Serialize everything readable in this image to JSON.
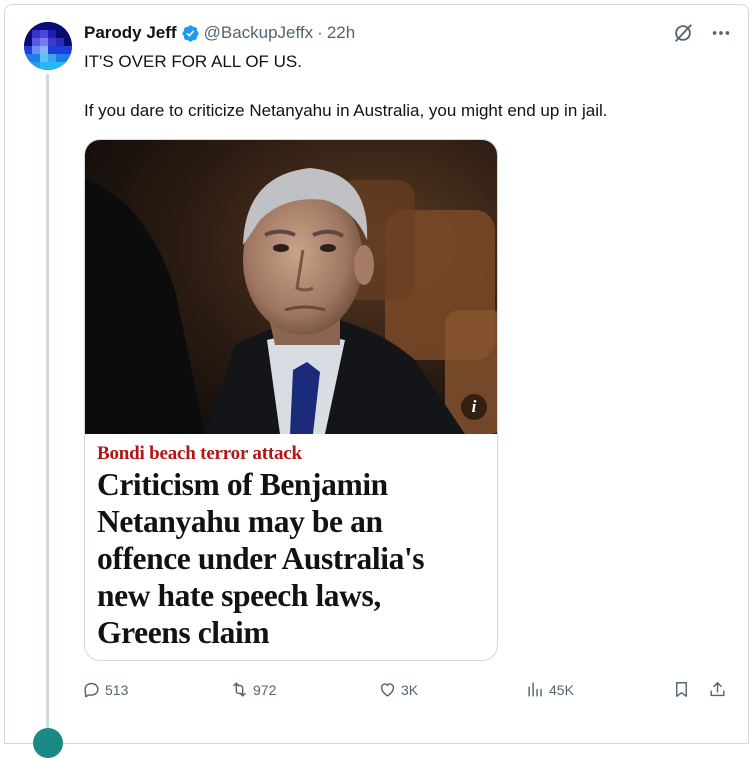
{
  "tweet": {
    "display_name": "Parody Jeff",
    "handle": "@BackupJeffx",
    "separator": "·",
    "time": "22h",
    "line1": "IT'S OVER FOR ALL OF US.",
    "line2": "If you dare to criticize Netanyahu in Australia, you might end up in jail."
  },
  "card": {
    "kicker": "Bondi beach terror attack",
    "headline_lines": [
      "Criticism of Benjamin",
      "Netanyahu may be an",
      "offence under Australia's",
      "new hate speech laws,",
      "Greens claim"
    ],
    "info_badge": "i"
  },
  "actions": {
    "replies": "513",
    "reposts": "972",
    "likes": "3K",
    "views": "45K"
  },
  "colors": {
    "verified": "#1d9bf0",
    "kicker": "#b01616",
    "muted": "#536471"
  }
}
